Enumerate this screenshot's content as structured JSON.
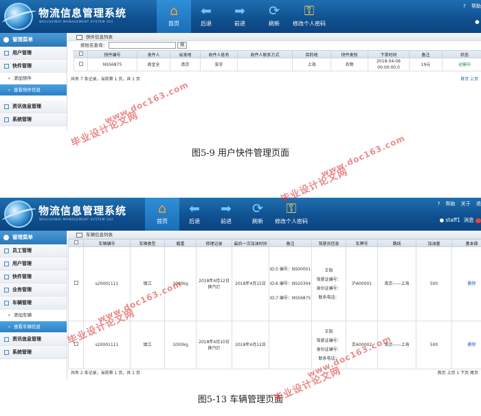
{
  "app": {
    "title": "物流信息管理系统",
    "subtitle": "WULIUXINXI MANAGEMENT SYSTEM GUI",
    "nav": [
      {
        "label": "首页",
        "icon": "home-icon"
      },
      {
        "label": "后退",
        "icon": "arrow-left-icon"
      },
      {
        "label": "前进",
        "icon": "arrow-right-icon"
      },
      {
        "label": "刷新",
        "icon": "refresh-icon"
      },
      {
        "label": "修改个人密码",
        "icon": "key-icon"
      }
    ],
    "help": "帮助",
    "about": "关于",
    "exit": "退",
    "help_cut": "帮助",
    "user": "staff1",
    "msg": "消息",
    "sidebar_title": "管理菜单"
  },
  "screen1": {
    "sidebar": [
      {
        "label": "用户管理"
      },
      {
        "label": "快件管理"
      }
    ],
    "sub": [
      {
        "label": "添加快件"
      },
      {
        "label": "查看快件信息"
      }
    ],
    "sidebar_after": [
      {
        "label": "资讯信息管理"
      },
      {
        "label": "系统管理"
      }
    ],
    "crumb": "快件信息列表",
    "search_label": "按姓名查询：",
    "search_button": "搜",
    "table": {
      "headers": [
        "",
        "快件编号",
        "发件人",
        "出发地",
        "收件人姓名",
        "收件人联系方式",
        "目的地",
        "快件类别",
        "下单时间",
        "备注",
        "状态"
      ],
      "row": [
        "NS56875",
        "周金全",
        "南京",
        "张宇",
        "",
        "上海",
        "衣物",
        "2018-04-06 00:00:00.0",
        "19元",
        "运输中"
      ]
    },
    "pager_left": "共有 7 条记录，当前第 1 页，共 1 页",
    "pager_right": "首页 上页"
  },
  "caption1": "图5-9    用户快件管理页面",
  "screen2": {
    "sidebar": [
      {
        "label": "员工管理"
      },
      {
        "label": "用户管理"
      },
      {
        "label": "快件管理"
      },
      {
        "label": "业务管理"
      },
      {
        "label": "车辆管理"
      }
    ],
    "sub": [
      {
        "label": "添加车辆"
      },
      {
        "label": "查看车辆信息"
      }
    ],
    "sidebar_after": [
      {
        "label": "资讯信息管理"
      },
      {
        "label": "系统管理"
      }
    ],
    "crumb": "车辆信息列表",
    "table": {
      "headers": [
        "",
        "车辆编号",
        "车辆类型",
        "载重",
        "修理记录",
        "最后一次加油时间",
        "备注",
        "驾驶员信息",
        "车牌号",
        "路线",
        "加油量",
        "基本操"
      ],
      "rows": [
        {
          "id": "s20001111",
          "type": "镇江",
          "load": "1000kg",
          "repair": "2018年4月12日 换汽灯",
          "fuel_time": "2018年4月15日",
          "notes": [
            "ID:5 编号：NS00001",
            "ID:6 编号：NS20304",
            "ID:7 编号：NS56875"
          ],
          "driver": [
            "王阳",
            "驾驶证编号：",
            "身份证编号：",
            "联系电话："
          ],
          "plate": "沪A00001",
          "route": "南京——上海",
          "fuel": "500",
          "op": "删除"
        },
        {
          "id": "s20001111",
          "type": "镇江",
          "load": "1000kg",
          "repair": "2018年4月10日 换汽灯",
          "fuel_time": "2018年4月12日",
          "notes": [],
          "driver": [
            "王阳",
            "驾驶证编号：",
            "身份证编号：",
            "联系电话："
          ],
          "plate": "京A00002",
          "route": "南京——上海",
          "fuel": "500",
          "op": "删除"
        }
      ]
    },
    "pager_left": "共有 2 条记录，当前第 1 页，共 1 页",
    "pager_right": "首页 上页 1 下页 尾页"
  },
  "caption2": "图5-13    车辆管理页面",
  "watermarks": [
    "毕业设计论文网",
    "www.doc163.com"
  ]
}
